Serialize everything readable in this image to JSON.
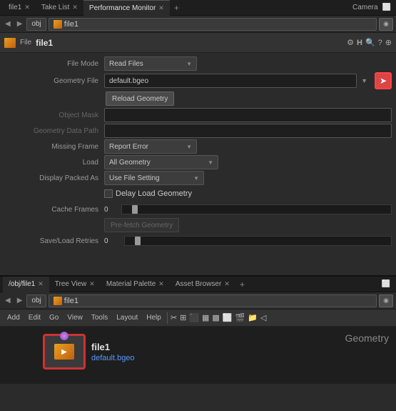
{
  "top_tabs": {
    "tabs": [
      {
        "label": "file1",
        "active": false,
        "closable": true
      },
      {
        "label": "Take List",
        "active": false,
        "closable": true
      },
      {
        "label": "Performance Monitor",
        "active": true,
        "closable": true
      }
    ],
    "add_label": "+",
    "camera_label": "Camera"
  },
  "nav": {
    "back_label": "◀",
    "forward_label": "▶",
    "obj_label": "obj",
    "file1_label": "file1",
    "pin_label": "◉"
  },
  "header": {
    "title": "file1",
    "file_label": "File",
    "icons": [
      "⚙",
      "H",
      "🔍",
      "?",
      "⊕"
    ]
  },
  "properties": {
    "file_mode_label": "File Mode",
    "file_mode_value": "Read Files",
    "geometry_file_label": "Geometry File",
    "geometry_file_value": "default.bgeo",
    "reload_label": "Reload Geometry",
    "object_mask_label": "Object Mask",
    "geometry_data_path_label": "Geometry Data Path",
    "missing_frame_label": "Missing Frame",
    "missing_frame_value": "Report Error",
    "load_label": "Load",
    "load_value": "All Geometry",
    "display_packed_as_label": "Display Packed As",
    "display_packed_as_value": "Use File Setting",
    "delay_load_label": "Delay Load Geometry",
    "cache_frames_label": "Cache Frames",
    "cache_frames_value": "0",
    "prefetch_label": "Pre-fetch Geometry",
    "save_load_retries_label": "Save/Load Retries",
    "save_load_retries_value": "0"
  },
  "bottom_tabs": {
    "tabs": [
      {
        "label": "/obj/file1",
        "active": true,
        "closable": true
      },
      {
        "label": "Tree View",
        "active": false,
        "closable": true
      },
      {
        "label": "Material Palette",
        "active": false,
        "closable": true
      },
      {
        "label": "Asset Browser",
        "active": false,
        "closable": true
      }
    ],
    "add_label": "+"
  },
  "bottom_nav": {
    "obj_label": "obj",
    "file1_label": "file1"
  },
  "bottom_toolbar": {
    "items": [
      "Add",
      "Edit",
      "Go",
      "View",
      "Tools",
      "Layout",
      "Help"
    ]
  },
  "viewport": {
    "geometry_label": "Geometry",
    "node_name": "file1",
    "node_file": "default.bgeo"
  }
}
